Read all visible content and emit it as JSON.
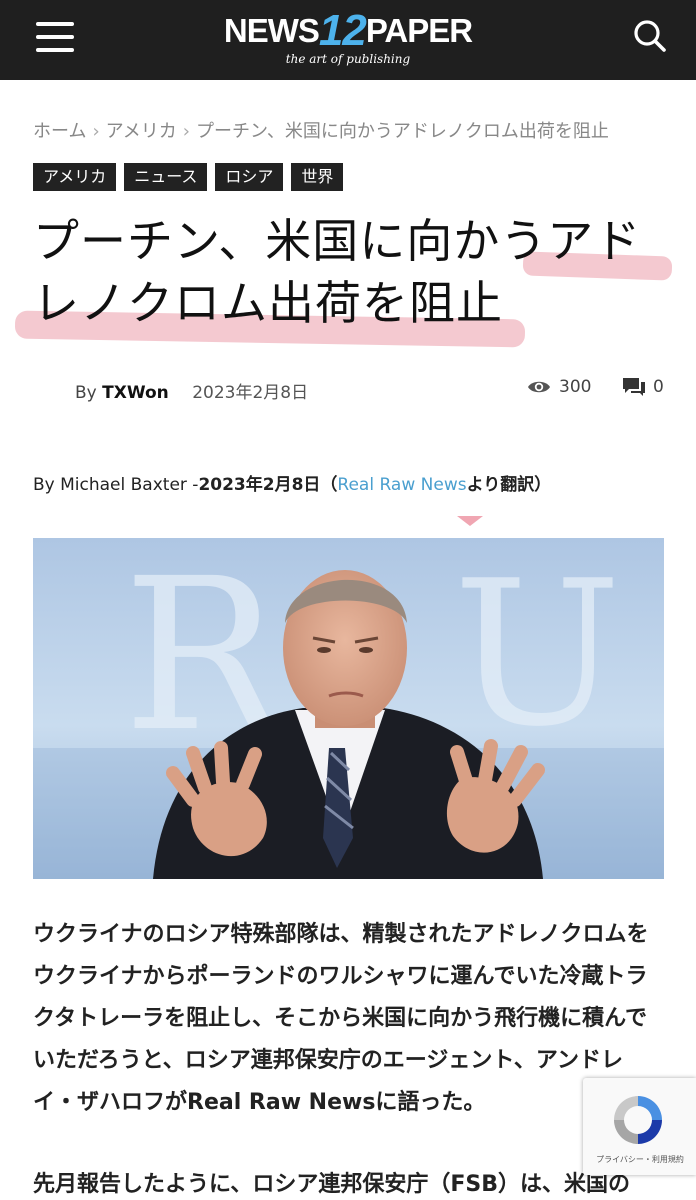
{
  "header": {
    "logo_news": "NEWS",
    "logo_number": "12",
    "logo_paper": "PAPER",
    "logo_tagline": "the art of publishing",
    "menu_icon": "hamburger-menu-icon",
    "search_icon": "search-icon",
    "background_color": "#1f1f1f",
    "accent_color": "#4db2ec"
  },
  "breadcrumb": {
    "items": [
      "ホーム",
      "アメリカ",
      "プーチン、米国に向かうアドレノクロム出荷を阻止"
    ],
    "separator": "›"
  },
  "tags": [
    "アメリカ",
    "ニュース",
    "ロシア",
    "世界"
  ],
  "article": {
    "title": "プーチン、米国に向かうアドレノクロム出荷を阻止",
    "by_label": "By",
    "author": "TXWon",
    "date": "2023年2月8日",
    "views": "300",
    "comments": "0",
    "byline_prefix": "By Michael Baxter -",
    "byline_date": "2023年2月8日",
    "byline_open": "（",
    "byline_source": "Real Raw News",
    "byline_suffix": "より翻訳）",
    "paragraph1": "ウクライナのロシア特殊部隊は、精製されたアドレノクロムをウクライナからポーランドのワルシャワに運んでいた冷蔵トラクタトレーラを阻止し、そこから米国に向かう飛行機に積んでいただろうと、ロシア連邦保安庁のエージェント、アンドレイ・ザハロフがReal Raw Newsに語った。",
    "paragraph2": "先月報告したように、ロシア連邦保安庁（FSB）は、米国の",
    "highlight_color": "#f0b7c0",
    "link_color": "#4a9fcf"
  },
  "recaptcha": {
    "legal": "プライバシー・利用規約",
    "icon": "recaptcha-icon"
  }
}
